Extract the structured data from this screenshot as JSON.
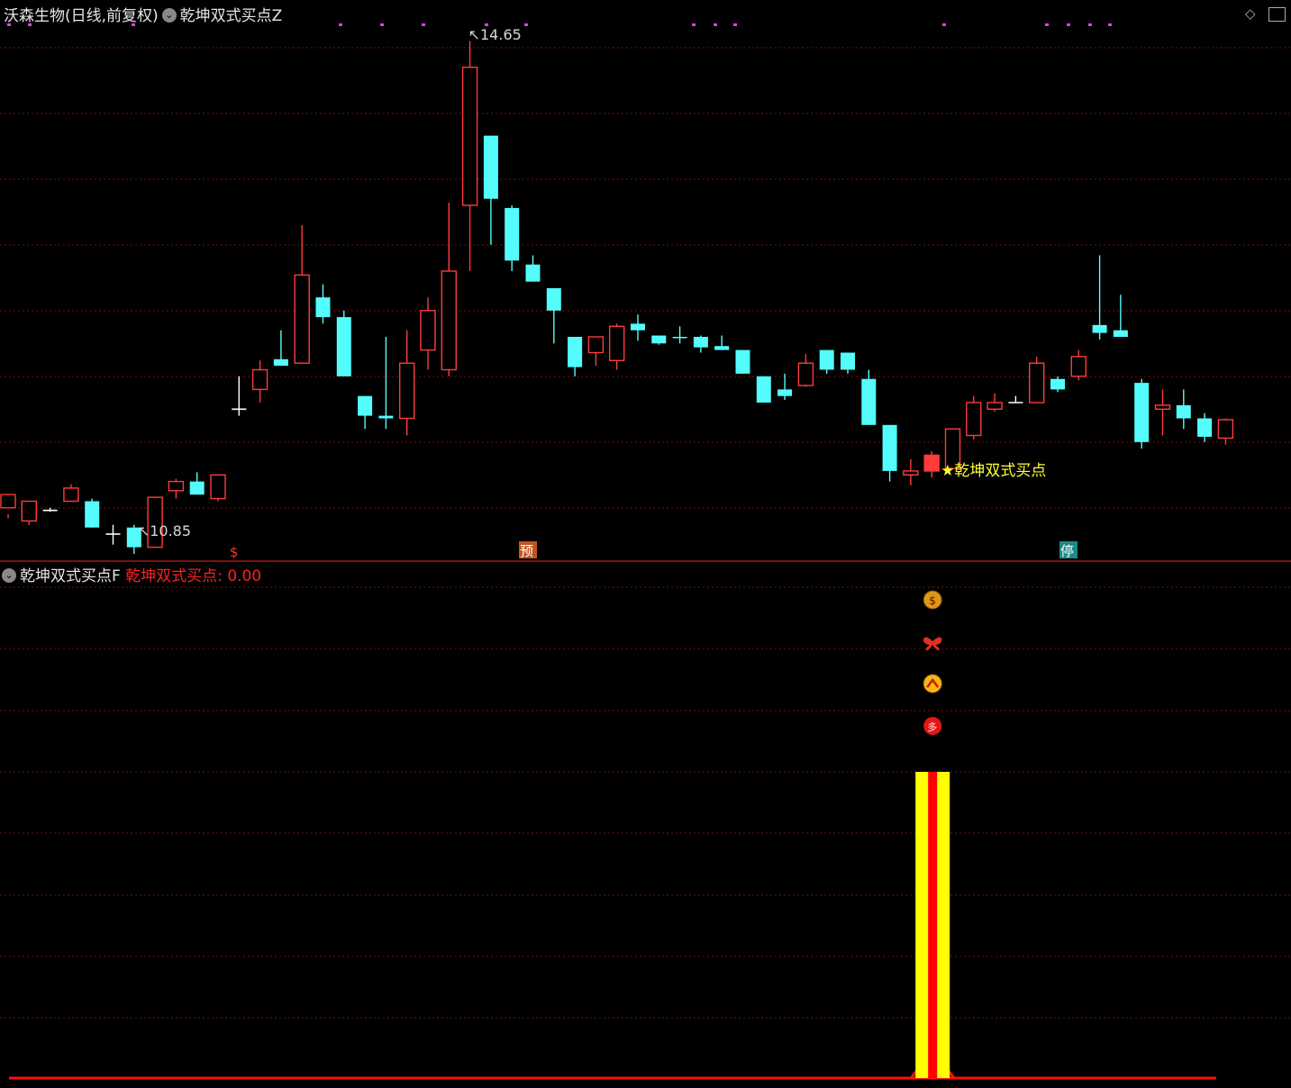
{
  "header_top": {
    "stock": "沃森生物(日线,前复权)",
    "indicator": "乾坤双式买点Z"
  },
  "header_bottom": {
    "indicator": "乾坤双式买点F",
    "value_label": "乾坤双式买点:",
    "value": "0.00"
  },
  "icons": [
    "diamond-icon",
    "window-icon",
    "chevron-circle-icon"
  ],
  "colors": {
    "up": "#ff3b3b",
    "down": "#54fcfc",
    "grid": "#7a1010",
    "signal_text": "#ffff33",
    "bar_yellow": "#ffff00",
    "bar_red": "#ff0000",
    "dots": "#ff33ff"
  },
  "chart_data": [
    {
      "type": "candlestick",
      "high_label": "14.65",
      "low_label": "10.85",
      "signal_label": "★乾坤双式买点",
      "markers": [
        "$",
        "预",
        "停"
      ],
      "candles": [
        [
          11.2,
          11.3,
          11.15,
          11.12
        ],
        [
          11.1,
          11.25,
          11.25,
          11.07
        ],
        [
          11.18,
          11.18,
          11.2,
          11.17
        ],
        [
          11.25,
          11.35,
          11.38,
          11.25
        ],
        [
          11.25,
          11.05,
          11.27,
          11.05
        ],
        [
          11.0,
          11.0,
          11.07,
          10.92
        ],
        [
          11.05,
          10.9,
          11.07,
          10.85
        ],
        [
          10.9,
          11.28,
          11.28,
          10.9
        ],
        [
          11.33,
          11.4,
          11.42,
          11.27
        ],
        [
          11.4,
          11.3,
          11.47,
          11.3
        ],
        [
          11.27,
          11.45,
          11.45,
          11.25
        ],
        [
          11.95,
          11.95,
          12.2,
          11.9
        ],
        [
          12.1,
          12.25,
          12.32,
          12.0
        ],
        [
          12.33,
          12.28,
          12.55,
          12.28
        ],
        [
          12.3,
          12.97,
          13.35,
          12.3
        ],
        [
          12.8,
          12.65,
          12.9,
          12.6
        ],
        [
          12.65,
          12.2,
          12.7,
          12.2
        ],
        [
          12.05,
          11.9,
          12.05,
          11.8
        ],
        [
          11.9,
          11.88,
          12.5,
          11.8
        ],
        [
          11.88,
          12.3,
          12.55,
          11.75
        ],
        [
          12.4,
          12.7,
          12.8,
          12.25
        ],
        [
          12.25,
          13.0,
          13.52,
          12.2
        ],
        [
          13.5,
          14.55,
          14.75,
          13.0
        ],
        [
          14.03,
          13.55,
          14.03,
          13.2
        ],
        [
          13.48,
          13.08,
          13.5,
          13.0
        ],
        [
          13.05,
          12.92,
          13.12,
          12.92
        ],
        [
          12.87,
          12.7,
          12.87,
          12.45
        ],
        [
          12.5,
          12.27,
          12.5,
          12.2
        ],
        [
          12.38,
          12.5,
          12.5,
          12.28
        ],
        [
          12.32,
          12.58,
          12.6,
          12.25
        ],
        [
          12.6,
          12.55,
          12.67,
          12.47
        ],
        [
          12.51,
          12.45,
          12.51,
          12.44
        ],
        [
          12.5,
          12.49,
          12.58,
          12.45
        ],
        [
          12.5,
          12.42,
          12.51,
          12.38
        ],
        [
          12.43,
          12.4,
          12.51,
          12.4
        ],
        [
          12.4,
          12.22,
          12.4,
          12.22
        ],
        [
          12.2,
          12.0,
          12.2,
          12.0
        ],
        [
          12.1,
          12.05,
          12.22,
          12.02
        ],
        [
          12.13,
          12.3,
          12.37,
          12.12
        ],
        [
          12.4,
          12.25,
          12.38,
          12.22
        ],
        [
          12.38,
          12.25,
          12.38,
          12.22
        ],
        [
          12.18,
          11.83,
          12.25,
          11.83
        ],
        [
          11.83,
          11.48,
          11.83,
          11.4
        ],
        [
          11.45,
          11.48,
          11.57,
          11.37
        ],
        [
          11.48,
          11.6,
          11.63,
          11.43
        ],
        [
          11.5,
          11.8,
          11.8,
          11.5
        ],
        [
          11.75,
          12.0,
          12.05,
          11.72
        ],
        [
          11.95,
          12.0,
          12.07,
          11.93
        ],
        [
          12.0,
          12.0,
          12.05,
          12.0
        ],
        [
          12.0,
          12.3,
          12.35,
          12.0
        ],
        [
          12.18,
          12.1,
          12.2,
          12.08
        ],
        [
          12.2,
          12.35,
          12.4,
          12.17
        ],
        [
          12.59,
          12.53,
          13.12,
          12.48
        ],
        [
          12.55,
          12.5,
          12.82,
          12.5
        ],
        [
          12.15,
          11.7,
          12.18,
          11.65
        ],
        [
          11.95,
          11.98,
          12.1,
          11.75
        ],
        [
          11.98,
          11.88,
          12.1,
          11.8
        ],
        [
          11.88,
          11.74,
          11.92,
          11.7
        ],
        [
          11.73,
          11.87,
          11.88,
          11.68
        ]
      ]
    },
    {
      "type": "bar",
      "name": "乾坤双式买点",
      "signal_index": 44,
      "value_at_signal": 1,
      "icons": [
        "money-bag-icon",
        "butterfly-icon",
        "up-arrow-circle-icon",
        "duo-badge-icon"
      ]
    }
  ]
}
